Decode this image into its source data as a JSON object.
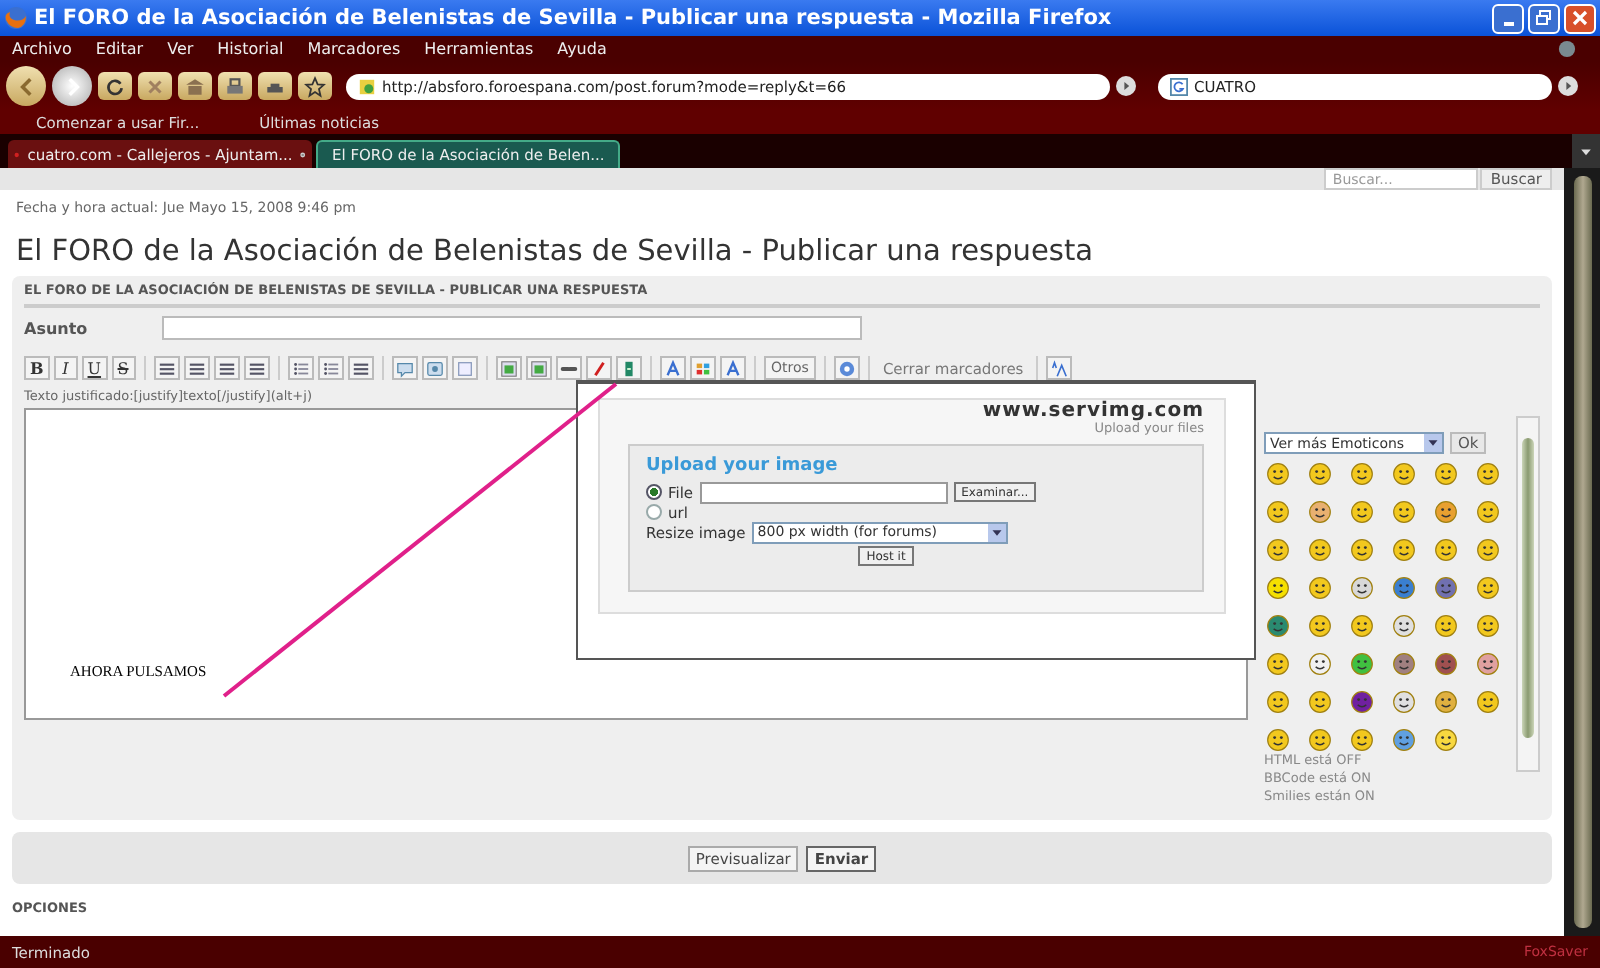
{
  "window": {
    "title": "El FORO de la Asociación de Belenistas de Sevilla - Publicar una respuesta - Mozilla Firefox"
  },
  "menu": [
    "Archivo",
    "Editar",
    "Ver",
    "Historial",
    "Marcadores",
    "Herramientas",
    "Ayuda"
  ],
  "address_bar": {
    "value": "http://absforo.foroespana.com/post.forum?mode=reply&t=66"
  },
  "search_engine_field": {
    "value": "CUATRO"
  },
  "bookmarks": [
    "Comenzar a usar Fir...",
    "Últimas noticias"
  ],
  "tabs": [
    {
      "label": "cuatro.com - Callejeros - Ajuntam...",
      "selected": false
    },
    {
      "label": "El FORO de la Asociación de Belen...",
      "selected": true
    }
  ],
  "page": {
    "search": {
      "placeholder": "Buscar...",
      "button": "Buscar"
    },
    "datetime": "Fecha y hora actual: Jue Mayo 15, 2008 9:46 pm",
    "heading": "El FORO de la Asociación de Belenistas de Sevilla - Publicar una respuesta",
    "panel_title": "EL FORO DE LA ASOCIACIÓN DE BELENISTAS DE SEVILLA - PUBLICAR UNA RESPUESTA",
    "subject_label": "Asunto",
    "toolbar": [
      {
        "kind": "bold",
        "label": "B"
      },
      {
        "kind": "italic",
        "label": "I"
      },
      {
        "kind": "underline",
        "label": "U"
      },
      {
        "kind": "strike",
        "label": "S"
      },
      {
        "kind": "sep"
      },
      {
        "kind": "align"
      },
      {
        "kind": "align"
      },
      {
        "kind": "align"
      },
      {
        "kind": "align"
      },
      {
        "kind": "sep"
      },
      {
        "kind": "list"
      },
      {
        "kind": "list"
      },
      {
        "kind": "rule"
      },
      {
        "kind": "sep"
      },
      {
        "kind": "bubble"
      },
      {
        "kind": "code"
      },
      {
        "kind": "page"
      },
      {
        "kind": "sep"
      },
      {
        "kind": "picture"
      },
      {
        "kind": "picture"
      },
      {
        "kind": "link"
      },
      {
        "kind": "pen"
      },
      {
        "kind": "film"
      },
      {
        "kind": "sep"
      },
      {
        "kind": "letter"
      },
      {
        "kind": "grid"
      },
      {
        "kind": "letter"
      },
      {
        "kind": "sep"
      },
      {
        "kind": "text",
        "label": "Otros"
      },
      {
        "kind": "sep"
      },
      {
        "kind": "help"
      },
      {
        "kind": "sep"
      },
      {
        "kind": "flat",
        "label": "Cerrar marcadores"
      },
      {
        "kind": "sep"
      },
      {
        "kind": "fontsize"
      }
    ],
    "hint": "Texto justificado:[justify]texto[/justify](alt+j)",
    "editor_text": "AHORA PULSAMOS",
    "upload_dialog": {
      "logo": "www.servimg.com",
      "tagline": "Upload your files",
      "title": "Upload your image",
      "sources": [
        {
          "label": "File",
          "selected": true
        },
        {
          "label": "url",
          "selected": false
        }
      ],
      "browse_button": "Examinar...",
      "resize_label": "Resize image",
      "resize_value": "800 px width (for forums)",
      "submit": "Host it"
    },
    "emoticons": {
      "select": "Ver más Emoticons",
      "ok": "Ok"
    },
    "status_lines": [
      "HTML está OFF",
      "BBCode está ON",
      "Smilies están ON"
    ],
    "buttons": [
      {
        "label": "Previsualizar",
        "default": false
      },
      {
        "label": "Enviar",
        "default": true
      }
    ],
    "options_label": "OPCIONES"
  },
  "status_bar": {
    "text": "Terminado",
    "addon": "FoxSaver"
  }
}
